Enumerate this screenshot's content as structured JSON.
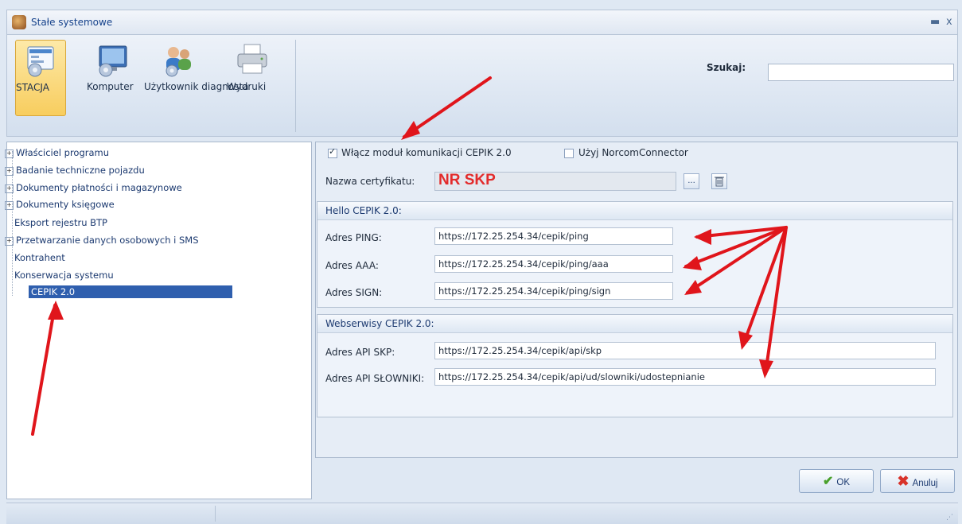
{
  "window": {
    "title": "Stałe systemowe",
    "minimize_label": "▬",
    "close_label": "x"
  },
  "ribbon": {
    "buttons": [
      {
        "label": "STACJA"
      },
      {
        "label": "Komputer"
      },
      {
        "label": "Użytkownik diagnosta"
      },
      {
        "label": "Wydruki"
      }
    ],
    "search_label": "Szukaj:",
    "search_value": ""
  },
  "tree": {
    "items": [
      {
        "label": "Właściciel programu",
        "expandable": true
      },
      {
        "label": "Badanie techniczne pojazdu",
        "expandable": true
      },
      {
        "label": "Dokumenty płatności i magazynowe",
        "expandable": true
      },
      {
        "label": "Dokumenty księgowe",
        "expandable": true
      },
      {
        "label": "Eksport rejestru BTP",
        "expandable": false
      },
      {
        "label": "Przetwarzanie danych osobowych i SMS",
        "expandable": true
      },
      {
        "label": "Kontrahent",
        "expandable": false
      },
      {
        "label": "Konserwacja systemu",
        "expandable": false
      },
      {
        "label": "CEPIK 2.0",
        "expandable": false,
        "selected": true
      }
    ]
  },
  "form": {
    "enable_cepik_label": "Włącz moduł komunikacji CEPIK 2.0",
    "enable_cepik_checked": true,
    "norcom_label": "Użyj NorcomConnector",
    "norcom_checked": false,
    "cert_label": "Nazwa certyfikatu:",
    "cert_value": "NR SKP",
    "browse_label": "...",
    "hello_group_title": "Hello CEPIK 2.0:",
    "ping_label": "Adres PING:",
    "ping_value": "https://172.25.254.34/cepik/ping",
    "aaa_label": "Adres AAA:",
    "aaa_value": "https://172.25.254.34/cepik/ping/aaa",
    "sign_label": "Adres SIGN:",
    "sign_value": "https://172.25.254.34/cepik/ping/sign",
    "ws_group_title": "Webserwisy CEPIK 2.0:",
    "api_skp_label": "Adres API SKP:",
    "api_skp_value": "https://172.25.254.34/cepik/api/skp",
    "api_slowniki_label": "Adres API SŁOWNIKI:",
    "api_slowniki_value": "https://172.25.254.34/cepik/api/ud/slowniki/udostepnianie"
  },
  "footer": {
    "ok_label": "OK",
    "cancel_label": "Anuluj"
  },
  "annotations": {
    "arrow_color": "#e0151b"
  }
}
